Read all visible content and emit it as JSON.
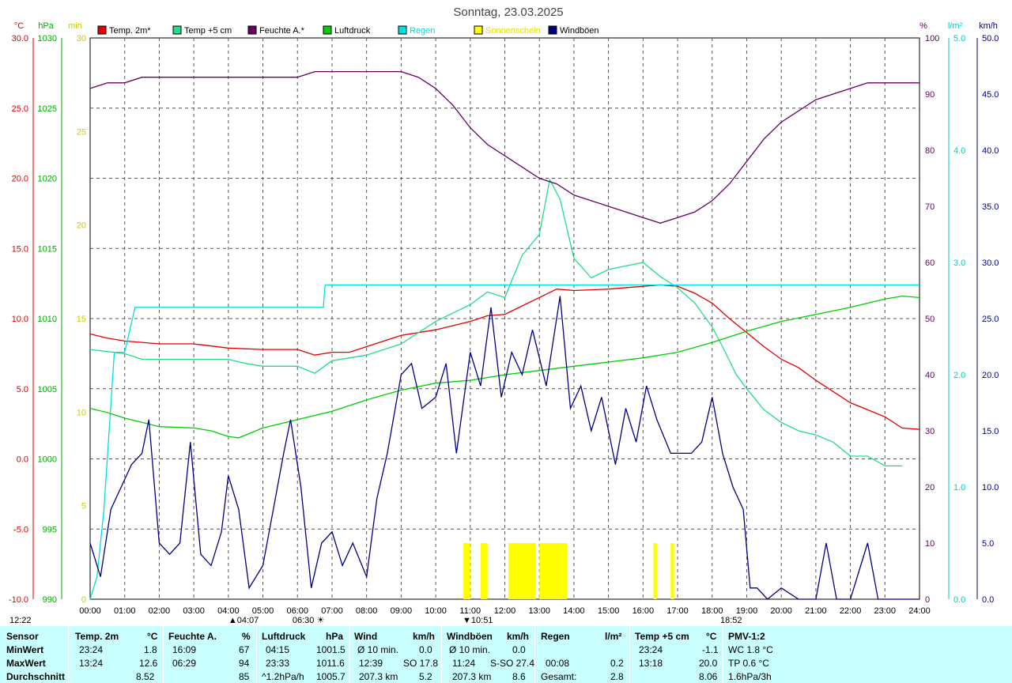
{
  "title": "Sonntag, 23.03.2025",
  "colors": {
    "temp2m": "#e00000",
    "temp5cm": "#22dd88",
    "humidity": "#660066",
    "pressure": "#00cc00",
    "rain": "#00e0e0",
    "sunshine": "#ffff00",
    "gusts": "#000080"
  },
  "legend": [
    {
      "label": "Temp. 2m*",
      "color": "#e00000"
    },
    {
      "label": "Temp +5 cm",
      "color": "#22dd88"
    },
    {
      "label": "Feuchte A.*",
      "color": "#660066"
    },
    {
      "label": "Luftdruck",
      "color": "#00cc00"
    },
    {
      "label": "Regen",
      "color": "#00e0e0"
    },
    {
      "label": "Sonnenschein",
      "color": "#ffff00"
    },
    {
      "label": "Windböen",
      "color": "#000080"
    }
  ],
  "axes": {
    "temp": {
      "unit": "°C",
      "ticks": [
        "30.0",
        "25.0",
        "20.0",
        "15.0",
        "10.0",
        "5.0",
        "0.0",
        "-5.0",
        "-10.0"
      ],
      "range": [
        -10,
        30
      ]
    },
    "pressure": {
      "unit": "hPa",
      "ticks": [
        "1030",
        "1025",
        "1020",
        "1015",
        "1010",
        "1005",
        "1000",
        "995",
        "990"
      ],
      "range": [
        990,
        1030
      ]
    },
    "sun": {
      "unit": "min",
      "ticks": [
        "30",
        "25",
        "20",
        "15",
        "10",
        "5",
        "0"
      ],
      "range": [
        0,
        30
      ]
    },
    "humidity": {
      "unit": "%",
      "ticks": [
        "100",
        "90",
        "80",
        "70",
        "60",
        "50",
        "40",
        "30",
        "20",
        "10",
        "0"
      ],
      "range": [
        0,
        100
      ]
    },
    "rain": {
      "unit": "l/m²",
      "ticks": [
        "5.0",
        "4.0",
        "3.0",
        "2.0",
        "1.0",
        "0.0"
      ],
      "range": [
        0,
        5
      ]
    },
    "wind": {
      "unit": "km/h",
      "ticks": [
        "50.0",
        "45.0",
        "40.0",
        "35.0",
        "30.0",
        "25.0",
        "20.0",
        "15.0",
        "10.0",
        "5.0",
        "0.0"
      ],
      "range": [
        0,
        50
      ]
    },
    "x": {
      "ticks": [
        "00:00",
        "01:00",
        "02:00",
        "03:00",
        "04:00",
        "05:00",
        "06:00",
        "07:00",
        "08:00",
        "09:00",
        "10:00",
        "11:00",
        "12:00",
        "13:00",
        "14:00",
        "15:00",
        "16:00",
        "17:00",
        "18:00",
        "19:00",
        "20:00",
        "21:00",
        "22:00",
        "23:00",
        "24:00"
      ],
      "range": [
        0,
        24
      ]
    }
  },
  "annotations": {
    "time_left": "12:22",
    "min_pressure_time": "04:07",
    "sunrise": "06:30",
    "wind_min_time": "10:51",
    "sunset": "18:52"
  },
  "chart_data": {
    "type": "line",
    "title": "Sonntag, 23.03.2025",
    "x_unit": "hour",
    "xlim": [
      0,
      24
    ],
    "grid": true,
    "legend_position": "top",
    "series": [
      {
        "name": "Temp. 2m*",
        "axis": "temp",
        "points": [
          [
            0,
            8.9
          ],
          [
            0.5,
            8.6
          ],
          [
            1,
            8.4
          ],
          [
            2,
            8.2
          ],
          [
            3,
            8.2
          ],
          [
            4,
            7.9
          ],
          [
            5,
            7.8
          ],
          [
            6,
            7.8
          ],
          [
            6.5,
            7.4
          ],
          [
            7,
            7.6
          ],
          [
            7.5,
            7.6
          ],
          [
            8,
            8.0
          ],
          [
            8.5,
            8.4
          ],
          [
            9,
            8.8
          ],
          [
            10,
            9.2
          ],
          [
            11,
            9.8
          ],
          [
            11.5,
            10.2
          ],
          [
            12,
            10.3
          ],
          [
            12.5,
            10.9
          ],
          [
            13,
            11.5
          ],
          [
            13.5,
            12.1
          ],
          [
            14,
            12.0
          ],
          [
            15,
            12.1
          ],
          [
            16,
            12.3
          ],
          [
            16.5,
            12.4
          ],
          [
            17,
            12.3
          ],
          [
            17.5,
            11.8
          ],
          [
            18,
            11.1
          ],
          [
            18.5,
            10.0
          ],
          [
            19,
            9.0
          ],
          [
            19.5,
            8.0
          ],
          [
            20,
            7.1
          ],
          [
            20.5,
            6.5
          ],
          [
            21,
            5.6
          ],
          [
            21.5,
            4.8
          ],
          [
            22,
            4.0
          ],
          [
            22.5,
            3.5
          ],
          [
            23,
            3.0
          ],
          [
            23.5,
            2.2
          ],
          [
            24,
            2.1
          ]
        ]
      },
      {
        "name": "Temp +5 cm",
        "axis": "temp",
        "points": [
          [
            0,
            7.8
          ],
          [
            1,
            7.5
          ],
          [
            1.5,
            7.1
          ],
          [
            2,
            7.1
          ],
          [
            3,
            7.1
          ],
          [
            4,
            7.1
          ],
          [
            4.5,
            6.8
          ],
          [
            5,
            6.6
          ],
          [
            6,
            6.6
          ],
          [
            6.5,
            6.1
          ],
          [
            7,
            7.0
          ],
          [
            8,
            7.4
          ],
          [
            9,
            8.2
          ],
          [
            10,
            9.8
          ],
          [
            10.5,
            10.4
          ],
          [
            11,
            11.0
          ],
          [
            11.5,
            11.9
          ],
          [
            12,
            11.5
          ],
          [
            12.5,
            14.5
          ],
          [
            13,
            16.0
          ],
          [
            13.3,
            19.9
          ],
          [
            13.6,
            18.5
          ],
          [
            14,
            14.3
          ],
          [
            14.5,
            12.9
          ],
          [
            15,
            13.5
          ],
          [
            16,
            14.0
          ],
          [
            16.5,
            13.0
          ],
          [
            17,
            12.2
          ],
          [
            17.5,
            11.1
          ],
          [
            18,
            9.4
          ],
          [
            18.3,
            8.0
          ],
          [
            18.7,
            6.0
          ],
          [
            19,
            5.0
          ],
          [
            19.5,
            3.5
          ],
          [
            20,
            2.6
          ],
          [
            20.5,
            2.0
          ],
          [
            21,
            1.7
          ],
          [
            21.5,
            1.2
          ],
          [
            22,
            0.2
          ],
          [
            22.5,
            0.2
          ],
          [
            23,
            -0.5
          ],
          [
            23.5,
            -0.5
          ]
        ]
      },
      {
        "name": "Feuchte A.*",
        "axis": "humidity",
        "points": [
          [
            0,
            91
          ],
          [
            0.5,
            92
          ],
          [
            1,
            92
          ],
          [
            1.5,
            93
          ],
          [
            2,
            93
          ],
          [
            3,
            93
          ],
          [
            4,
            93
          ],
          [
            6,
            93
          ],
          [
            6.5,
            94
          ],
          [
            7,
            94
          ],
          [
            8,
            94
          ],
          [
            9,
            94
          ],
          [
            9.5,
            93
          ],
          [
            10,
            91
          ],
          [
            10.5,
            88
          ],
          [
            11,
            84
          ],
          [
            11.5,
            81
          ],
          [
            12,
            79
          ],
          [
            12.5,
            77
          ],
          [
            13,
            75
          ],
          [
            13.5,
            74
          ],
          [
            14,
            72
          ],
          [
            14.5,
            71
          ],
          [
            15,
            70
          ],
          [
            15.5,
            69
          ],
          [
            16,
            68
          ],
          [
            16.5,
            67
          ],
          [
            17,
            68
          ],
          [
            17.5,
            69
          ],
          [
            18,
            71
          ],
          [
            18.5,
            74
          ],
          [
            19,
            78
          ],
          [
            19.5,
            82
          ],
          [
            20,
            85
          ],
          [
            20.5,
            87
          ],
          [
            21,
            89
          ],
          [
            21.5,
            90
          ],
          [
            22,
            91
          ],
          [
            22.5,
            92
          ],
          [
            23,
            92
          ],
          [
            23.5,
            92
          ],
          [
            24,
            92
          ]
        ]
      },
      {
        "name": "Luftdruck",
        "axis": "pressure",
        "points": [
          [
            0,
            1003.6
          ],
          [
            0.5,
            1003.3
          ],
          [
            1,
            1002.9
          ],
          [
            1.5,
            1002.6
          ],
          [
            2,
            1002.3
          ],
          [
            3,
            1002.2
          ],
          [
            3.5,
            1002.0
          ],
          [
            4,
            1001.6
          ],
          [
            4.3,
            1001.5
          ],
          [
            5,
            1002.2
          ],
          [
            6,
            1002.8
          ],
          [
            7,
            1003.4
          ],
          [
            8,
            1004.2
          ],
          [
            9,
            1004.9
          ],
          [
            10,
            1005.4
          ],
          [
            11,
            1005.6
          ],
          [
            12,
            1006.0
          ],
          [
            13,
            1006.3
          ],
          [
            14,
            1006.6
          ],
          [
            15,
            1006.9
          ],
          [
            16,
            1007.2
          ],
          [
            17,
            1007.6
          ],
          [
            18,
            1008.3
          ],
          [
            19,
            1009.1
          ],
          [
            20,
            1009.8
          ],
          [
            21,
            1010.3
          ],
          [
            22,
            1010.8
          ],
          [
            23,
            1011.4
          ],
          [
            23.5,
            1011.6
          ],
          [
            24,
            1011.5
          ]
        ]
      },
      {
        "name": "Regen",
        "axis": "rain",
        "points": [
          [
            0,
            0
          ],
          [
            0.2,
            0.2
          ],
          [
            0.4,
            0.8
          ],
          [
            0.7,
            2.2
          ],
          [
            1,
            2.2
          ],
          [
            1.3,
            2.6
          ],
          [
            1.4,
            2.6
          ],
          [
            2,
            2.6
          ],
          [
            3,
            2.6
          ],
          [
            4,
            2.6
          ],
          [
            5,
            2.6
          ],
          [
            6,
            2.6
          ],
          [
            6.75,
            2.6
          ],
          [
            6.8,
            2.8
          ],
          [
            7,
            2.8
          ],
          [
            10,
            2.8
          ],
          [
            12,
            2.8
          ],
          [
            15,
            2.8
          ],
          [
            18,
            2.8
          ],
          [
            21,
            2.8
          ],
          [
            24,
            2.8
          ]
        ]
      },
      {
        "name": "Windböen",
        "axis": "wind",
        "points": [
          [
            0,
            5
          ],
          [
            0.3,
            2
          ],
          [
            0.6,
            8
          ],
          [
            0.9,
            10
          ],
          [
            1.2,
            12
          ],
          [
            1.5,
            13
          ],
          [
            1.7,
            16
          ],
          [
            2,
            5
          ],
          [
            2.3,
            4
          ],
          [
            2.6,
            5
          ],
          [
            2.9,
            14
          ],
          [
            3.2,
            4
          ],
          [
            3.5,
            3
          ],
          [
            3.8,
            6
          ],
          [
            4,
            11
          ],
          [
            4.3,
            8
          ],
          [
            4.6,
            1
          ],
          [
            5,
            3
          ],
          [
            5.3,
            8
          ],
          [
            5.6,
            13
          ],
          [
            5.8,
            16
          ],
          [
            6.1,
            10
          ],
          [
            6.4,
            1
          ],
          [
            6.7,
            5
          ],
          [
            7,
            6
          ],
          [
            7.3,
            3
          ],
          [
            7.6,
            5
          ],
          [
            8,
            2
          ],
          [
            8.3,
            9
          ],
          [
            8.6,
            13
          ],
          [
            9,
            20
          ],
          [
            9.3,
            21
          ],
          [
            9.6,
            17
          ],
          [
            10,
            18
          ],
          [
            10.3,
            21
          ],
          [
            10.6,
            13
          ],
          [
            11,
            22
          ],
          [
            11.3,
            19
          ],
          [
            11.6,
            26
          ],
          [
            11.9,
            18
          ],
          [
            12.2,
            22
          ],
          [
            12.5,
            20
          ],
          [
            12.8,
            24
          ],
          [
            13.2,
            19
          ],
          [
            13.6,
            27
          ],
          [
            13.9,
            17
          ],
          [
            14.2,
            19
          ],
          [
            14.5,
            15
          ],
          [
            14.8,
            18
          ],
          [
            15.2,
            12
          ],
          [
            15.5,
            17
          ],
          [
            15.8,
            14
          ],
          [
            16.1,
            19
          ],
          [
            16.4,
            16
          ],
          [
            16.8,
            13
          ],
          [
            17.1,
            13
          ],
          [
            17.4,
            13
          ],
          [
            17.7,
            14
          ],
          [
            18,
            18
          ],
          [
            18.3,
            13
          ],
          [
            18.6,
            10
          ],
          [
            18.9,
            8
          ],
          [
            19.1,
            1
          ],
          [
            19.3,
            1
          ],
          [
            19.6,
            0
          ],
          [
            20,
            1
          ],
          [
            20.5,
            0
          ],
          [
            21,
            0
          ],
          [
            21.3,
            5
          ],
          [
            21.6,
            0
          ],
          [
            22,
            0
          ],
          [
            22.5,
            5
          ],
          [
            22.8,
            0
          ],
          [
            23,
            0
          ],
          [
            24,
            0
          ]
        ]
      }
    ],
    "sunshine_bars": [
      [
        10.8,
        11.0
      ],
      [
        11.3,
        11.5
      ],
      [
        12.1,
        12.9
      ],
      [
        13.0,
        13.8
      ],
      [
        16.3,
        16.4
      ],
      [
        16.8,
        16.9
      ]
    ]
  },
  "stats": {
    "sensor": {
      "title": "Sensor",
      "rows": [
        "MinWert",
        "MaxWert",
        "Durchschnitt"
      ]
    },
    "temp2m": {
      "title": "Temp. 2m",
      "unit": "°C",
      "min_time": "23:24",
      "min": "1.8",
      "max_time": "13:24",
      "max": "12.6",
      "avg": "8.52"
    },
    "humidity": {
      "title": "Feuchte A.",
      "unit": "%",
      "min_time": "16:09",
      "min": "67",
      "max_time": "06:29",
      "max": "94",
      "avg": "85"
    },
    "pressure": {
      "title": "Luftdruck",
      "unit": "hPa",
      "min_time": "04:15",
      "min": "1001.5",
      "max_time": "23:33",
      "max": "1011.6",
      "trend": "^1.2hPa/h",
      "avg": "1005.7"
    },
    "wind": {
      "title": "Wind",
      "unit": "km/h",
      "r1": "Ø 10 min.",
      "r1v": "0.0",
      "r2a": "12:39",
      "r2b": "SO 17.8",
      "r3a": "207.3 km",
      "r3v": "5.2"
    },
    "gusts": {
      "title": "Windböen",
      "unit": "km/h",
      "r1": "Ø 10 min.",
      "r1v": "0.0",
      "r2a": "11:24",
      "r2b": "S-SO 27.4",
      "r3a": "207.3 km",
      "r3v": "8.6"
    },
    "rain": {
      "title": "Regen",
      "unit": "l/m²",
      "r2a": "00:08",
      "r2v": "0.2",
      "r3a": "Gesamt:",
      "r3v": "2.8"
    },
    "temp5": {
      "title": "Temp +5 cm",
      "unit": "°C",
      "min_time": "23:24",
      "min": "-1.1",
      "max_time": "13:18",
      "max": "20.0",
      "avg": "8.06"
    },
    "pmv": {
      "title": "PMV-1:2",
      "r1": "WC 1.8 °C",
      "r2": "TP 0.6 °C",
      "r3": "1.6hPa/3h"
    }
  }
}
